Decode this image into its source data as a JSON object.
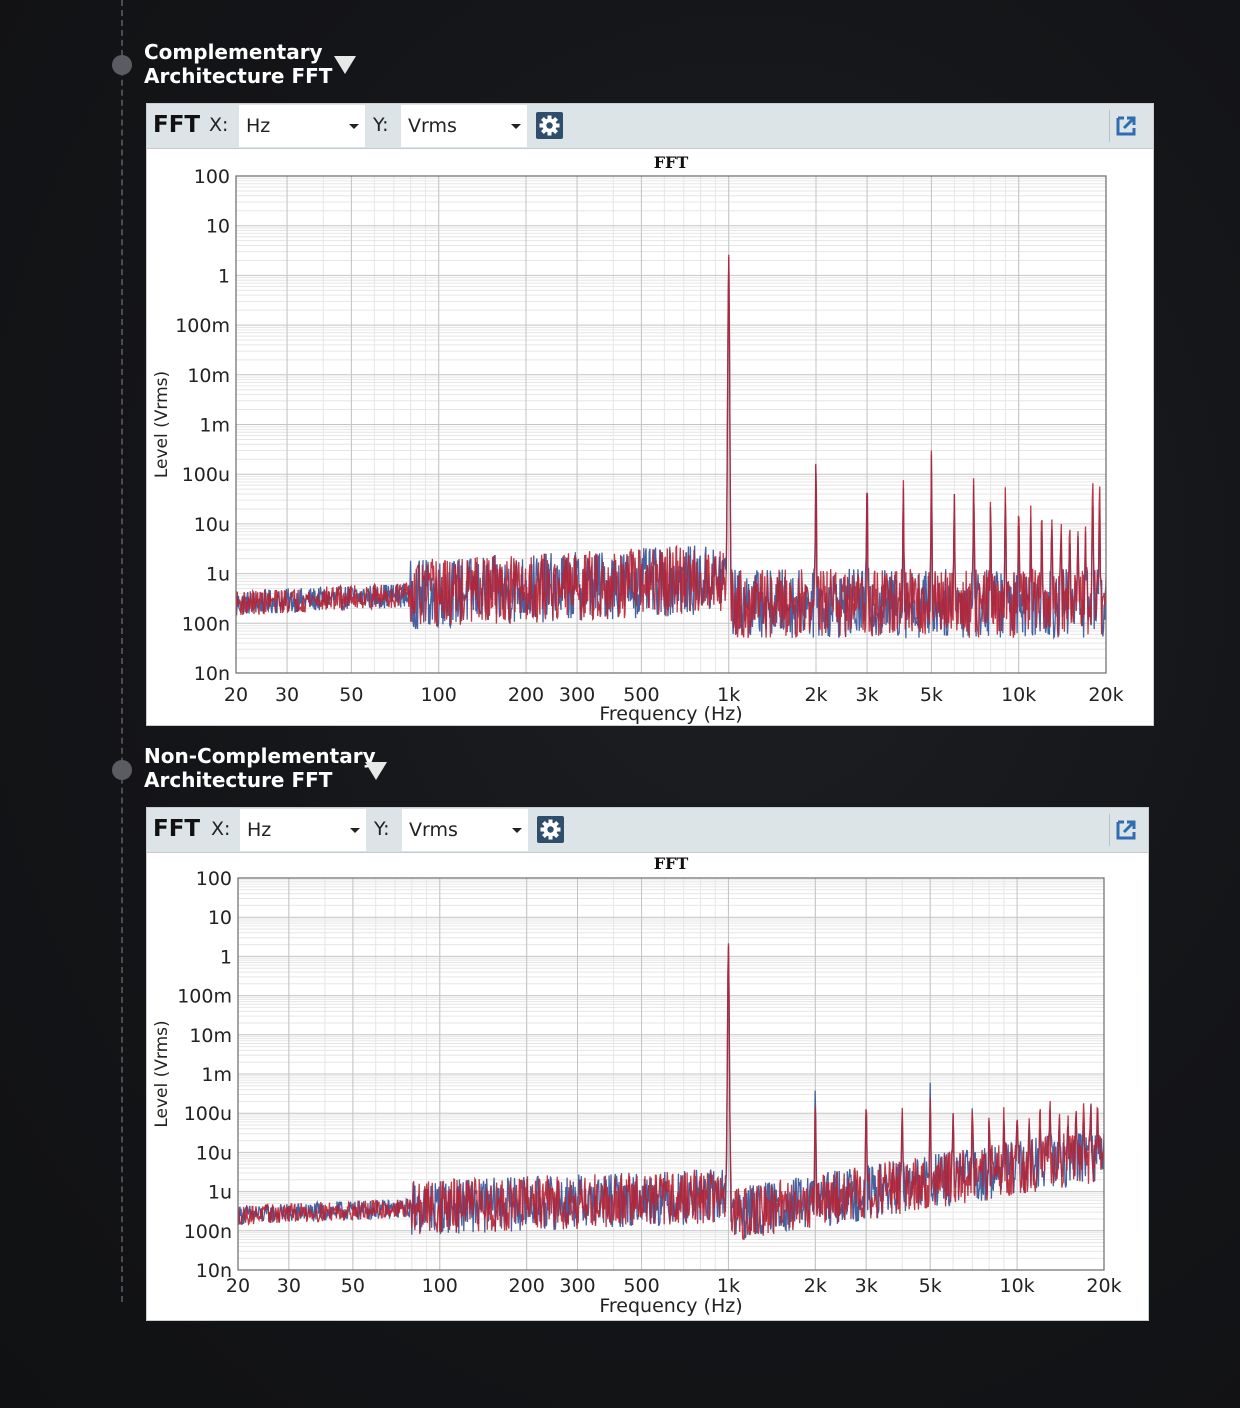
{
  "sections": [
    {
      "title_line1": "Complementary",
      "title_line2": "Architecture FFT",
      "toolbar": {
        "label": "FFT",
        "x_label": "X:",
        "x_unit": "Hz",
        "y_label": "Y:",
        "y_unit": "Vrms"
      }
    },
    {
      "title_line1": "Non-Complementary",
      "title_line2": "Architecture FFT",
      "toolbar": {
        "label": "FFT",
        "x_label": "X:",
        "x_unit": "Hz",
        "y_label": "Y:",
        "y_unit": "Vrms"
      }
    }
  ],
  "colors": {
    "series_blue": "#3d5a99",
    "series_red": "#b52435",
    "grid": "#cccccc",
    "toolbar_bg": "#dde4e8"
  },
  "icons": {
    "settings": "gear-icon",
    "popout": "popout-icon",
    "dropdown": "chevron-down-icon",
    "collapse": "caret-down-icon"
  },
  "chart_data": [
    {
      "type": "line",
      "title": "FFT",
      "xlabel": "Frequency (Hz)",
      "ylabel": "Level (Vrms)",
      "x_scale": "log",
      "y_scale": "log",
      "xlim": [
        20,
        20000
      ],
      "ylim": [
        1e-08,
        100
      ],
      "x_ticks": [
        20,
        30,
        50,
        100,
        200,
        300,
        500,
        1000,
        2000,
        3000,
        5000,
        10000,
        20000
      ],
      "x_tick_labels": [
        "20",
        "30",
        "50",
        "100",
        "200",
        "300",
        "500",
        "1k",
        "2k",
        "3k",
        "5k",
        "10k",
        "20k"
      ],
      "y_ticks": [
        100,
        10,
        1,
        0.1,
        0.01,
        0.001,
        0.0001,
        1e-05,
        1e-06,
        1e-07,
        1e-08
      ],
      "y_tick_labels": [
        "100",
        "10",
        "1",
        "100m",
        "10m",
        "1m",
        "100u",
        "10u",
        "1u",
        "100n",
        "10n"
      ],
      "grid": true,
      "series": [
        {
          "color": "#3d5a99",
          "peaks": [
            [
              1000,
              2.5
            ],
            [
              2000,
              0.00025
            ],
            [
              3000,
              9e-05
            ],
            [
              4000,
              6e-05
            ],
            [
              5000,
              0.00025
            ],
            [
              6000,
              4e-05
            ],
            [
              7000,
              7e-05
            ],
            [
              8000,
              3e-05
            ],
            [
              9000,
              3e-05
            ],
            [
              10000,
              2e-05
            ],
            [
              11000,
              1.5e-05
            ],
            [
              12000,
              1.2e-05
            ],
            [
              13000,
              1e-05
            ],
            [
              14000,
              8e-06
            ],
            [
              15000,
              5e-06
            ],
            [
              16000,
              6e-06
            ],
            [
              17000,
              7e-06
            ],
            [
              18000,
              3.5e-05
            ],
            [
              19000,
              3e-05
            ]
          ]
        },
        {
          "color": "#b52435",
          "peaks": [
            [
              1000,
              2.8
            ],
            [
              2000,
              0.0003
            ],
            [
              3000,
              0.00012
            ],
            [
              4000,
              9e-05
            ],
            [
              5000,
              0.0003
            ],
            [
              6000,
              4e-05
            ],
            [
              7000,
              0.00011
            ],
            [
              8000,
              4e-05
            ],
            [
              9000,
              6e-05
            ],
            [
              10000,
              3e-05
            ],
            [
              11000,
              2.5e-05
            ],
            [
              12000,
              2e-05
            ],
            [
              13000,
              1.5e-05
            ],
            [
              14000,
              1.2e-05
            ],
            [
              15000,
              1e-05
            ],
            [
              16000,
              8e-06
            ],
            [
              17000,
              9e-06
            ],
            [
              18000,
              0.00012
            ],
            [
              19000,
              0.0001
            ]
          ]
        }
      ]
    },
    {
      "type": "line",
      "title": "FFT",
      "xlabel": "Frequency (Hz)",
      "ylabel": "Level (Vrms)",
      "x_scale": "log",
      "y_scale": "log",
      "xlim": [
        20,
        20000
      ],
      "ylim": [
        1e-08,
        100
      ],
      "x_ticks": [
        20,
        30,
        50,
        100,
        200,
        300,
        500,
        1000,
        2000,
        3000,
        5000,
        10000,
        20000
      ],
      "x_tick_labels": [
        "20",
        "30",
        "50",
        "100",
        "200",
        "300",
        "500",
        "1k",
        "2k",
        "3k",
        "5k",
        "10k",
        "20k"
      ],
      "y_ticks": [
        100,
        10,
        1,
        0.1,
        0.01,
        0.001,
        0.0001,
        1e-05,
        1e-06,
        1e-07,
        1e-08
      ],
      "y_tick_labels": [
        "100",
        "10",
        "1",
        "100m",
        "10m",
        "1m",
        "100u",
        "10u",
        "1u",
        "100n",
        "10n"
      ],
      "grid": true,
      "series": [
        {
          "color": "#3d5a99",
          "peaks": [
            [
              1000,
              2.0
            ],
            [
              2000,
              0.0006
            ],
            [
              3000,
              0.0002
            ],
            [
              4000,
              0.00012
            ],
            [
              5000,
              0.0006
            ],
            [
              6000,
              0.0001
            ],
            [
              7000,
              0.00015
            ],
            [
              8000,
              8e-05
            ],
            [
              9000,
              7e-05
            ],
            [
              10000,
              0.0001
            ],
            [
              11000,
              6e-05
            ],
            [
              12000,
              5e-05
            ],
            [
              13000,
              0.00015
            ],
            [
              14000,
              8e-05
            ],
            [
              15000,
              5e-05
            ],
            [
              16000,
              0.00012
            ],
            [
              17000,
              6e-05
            ],
            [
              18000,
              0.00025
            ],
            [
              19000,
              0.00015
            ]
          ]
        },
        {
          "color": "#b52435",
          "peaks": [
            [
              1000,
              2.3
            ],
            [
              2000,
              0.00025
            ],
            [
              3000,
              0.00035
            ],
            [
              4000,
              0.00015
            ],
            [
              5000,
              0.00025
            ],
            [
              6000,
              0.0001
            ],
            [
              7000,
              0.00012
            ],
            [
              8000,
              0.0001
            ],
            [
              9000,
              0.00015
            ],
            [
              10000,
              0.00012
            ],
            [
              11000,
              8e-05
            ],
            [
              12000,
              0.0002
            ],
            [
              13000,
              0.00025
            ],
            [
              14000,
              0.00012
            ],
            [
              15000,
              0.0001
            ],
            [
              16000,
              0.00012
            ],
            [
              17000,
              0.00018
            ],
            [
              18000,
              0.00025
            ],
            [
              19000,
              0.0002
            ]
          ]
        }
      ]
    }
  ]
}
